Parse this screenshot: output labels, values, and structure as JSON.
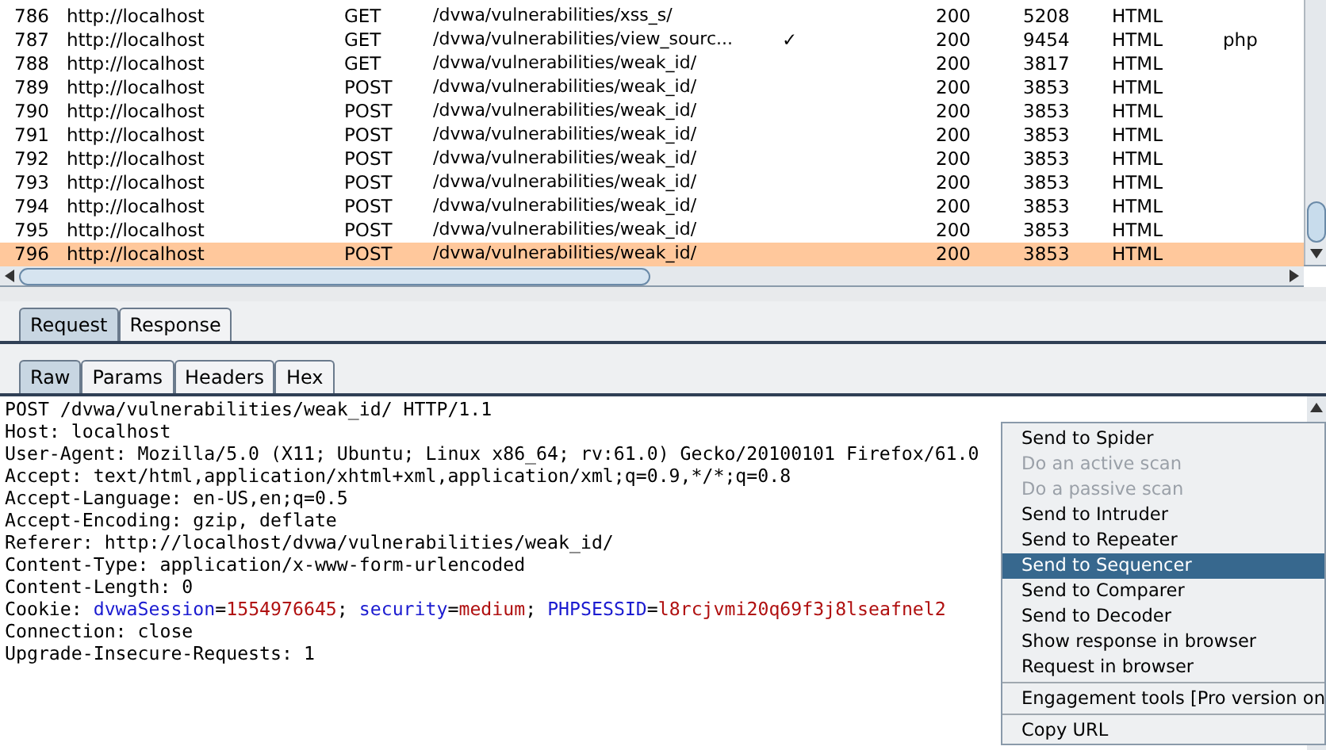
{
  "history_table": {
    "rows": [
      {
        "number": "786",
        "host": "http://localhost",
        "method": "GET",
        "url": "/dvwa/vulnerabilities/xss_s/",
        "column_5": "",
        "status": "200",
        "length": "5208",
        "mime_type": "HTML",
        "extension": "",
        "selected": false
      },
      {
        "number": "787",
        "host": "http://localhost",
        "method": "GET",
        "url": "/dvwa/vulnerabilities/view_sourc...",
        "column_5": "✓",
        "status": "200",
        "length": "9454",
        "mime_type": "HTML",
        "extension": "php",
        "selected": false
      },
      {
        "number": "788",
        "host": "http://localhost",
        "method": "GET",
        "url": "/dvwa/vulnerabilities/weak_id/",
        "column_5": "",
        "status": "200",
        "length": "3817",
        "mime_type": "HTML",
        "extension": "",
        "selected": false
      },
      {
        "number": "789",
        "host": "http://localhost",
        "method": "POST",
        "url": "/dvwa/vulnerabilities/weak_id/",
        "column_5": "",
        "status": "200",
        "length": "3853",
        "mime_type": "HTML",
        "extension": "",
        "selected": false
      },
      {
        "number": "790",
        "host": "http://localhost",
        "method": "POST",
        "url": "/dvwa/vulnerabilities/weak_id/",
        "column_5": "",
        "status": "200",
        "length": "3853",
        "mime_type": "HTML",
        "extension": "",
        "selected": false
      },
      {
        "number": "791",
        "host": "http://localhost",
        "method": "POST",
        "url": "/dvwa/vulnerabilities/weak_id/",
        "column_5": "",
        "status": "200",
        "length": "3853",
        "mime_type": "HTML",
        "extension": "",
        "selected": false
      },
      {
        "number": "792",
        "host": "http://localhost",
        "method": "POST",
        "url": "/dvwa/vulnerabilities/weak_id/",
        "column_5": "",
        "status": "200",
        "length": "3853",
        "mime_type": "HTML",
        "extension": "",
        "selected": false
      },
      {
        "number": "793",
        "host": "http://localhost",
        "method": "POST",
        "url": "/dvwa/vulnerabilities/weak_id/",
        "column_5": "",
        "status": "200",
        "length": "3853",
        "mime_type": "HTML",
        "extension": "",
        "selected": false
      },
      {
        "number": "794",
        "host": "http://localhost",
        "method": "POST",
        "url": "/dvwa/vulnerabilities/weak_id/",
        "column_5": "",
        "status": "200",
        "length": "3853",
        "mime_type": "HTML",
        "extension": "",
        "selected": false
      },
      {
        "number": "795",
        "host": "http://localhost",
        "method": "POST",
        "url": "/dvwa/vulnerabilities/weak_id/",
        "column_5": "",
        "status": "200",
        "length": "3853",
        "mime_type": "HTML",
        "extension": "",
        "selected": false
      },
      {
        "number": "796",
        "host": "http://localhost",
        "method": "POST",
        "url": "/dvwa/vulnerabilities/weak_id/",
        "column_5": "",
        "status": "200",
        "length": "3853",
        "mime_type": "HTML",
        "extension": "",
        "selected": true
      }
    ]
  },
  "message_tabs": [
    {
      "label": "Request",
      "selected": true
    },
    {
      "label": "Response",
      "selected": false
    }
  ],
  "view_tabs": [
    {
      "label": "Raw",
      "selected": true
    },
    {
      "label": "Params",
      "selected": false
    },
    {
      "label": "Headers",
      "selected": false
    },
    {
      "label": "Hex",
      "selected": false
    }
  ],
  "request_lines": [
    {
      "segments": [
        {
          "text": "POST /dvwa/vulnerabilities/weak_id/ HTTP/1.1",
          "kind": "plain"
        }
      ]
    },
    {
      "segments": [
        {
          "text": "Host: localhost",
          "kind": "plain"
        }
      ]
    },
    {
      "segments": [
        {
          "text": "User-Agent: Mozilla/5.0 (X11; Ubuntu; Linux x86_64; rv:61.0) Gecko/20100101 Firefox/61.0",
          "kind": "plain"
        }
      ]
    },
    {
      "segments": [
        {
          "text": "Accept: text/html,application/xhtml+xml,application/xml;q=0.9,*/*;q=0.8",
          "kind": "plain"
        }
      ]
    },
    {
      "segments": [
        {
          "text": "Accept-Language: en-US,en;q=0.5",
          "kind": "plain"
        }
      ]
    },
    {
      "segments": [
        {
          "text": "Accept-Encoding: gzip, deflate",
          "kind": "plain"
        }
      ]
    },
    {
      "segments": [
        {
          "text": "Referer: http://localhost/dvwa/vulnerabilities/weak_id/",
          "kind": "plain"
        }
      ]
    },
    {
      "segments": [
        {
          "text": "Content-Type: application/x-www-form-urlencoded",
          "kind": "plain"
        }
      ]
    },
    {
      "segments": [
        {
          "text": "Content-Length: 0",
          "kind": "plain"
        }
      ]
    },
    {
      "segments": [
        {
          "text": "Cookie: ",
          "kind": "plain"
        },
        {
          "text": "dvwaSession",
          "kind": "name"
        },
        {
          "text": "=",
          "kind": "plain"
        },
        {
          "text": "1554976645",
          "kind": "value"
        },
        {
          "text": "; ",
          "kind": "plain"
        },
        {
          "text": "security",
          "kind": "name"
        },
        {
          "text": "=",
          "kind": "plain"
        },
        {
          "text": "medium",
          "kind": "value"
        },
        {
          "text": "; ",
          "kind": "plain"
        },
        {
          "text": "PHPSESSID",
          "kind": "name"
        },
        {
          "text": "=",
          "kind": "plain"
        },
        {
          "text": "l8rcjvmi20q69f3j8lseafnel2",
          "kind": "value"
        }
      ]
    },
    {
      "segments": [
        {
          "text": "Connection: close",
          "kind": "plain"
        }
      ]
    },
    {
      "segments": [
        {
          "text": "Upgrade-Insecure-Requests: 1",
          "kind": "plain"
        }
      ]
    }
  ],
  "context_menu": [
    {
      "label": "Send to Spider",
      "disabled": false,
      "selected": false,
      "separator_before": false
    },
    {
      "label": "Do an active scan",
      "disabled": true,
      "selected": false,
      "separator_before": false
    },
    {
      "label": "Do a passive scan",
      "disabled": true,
      "selected": false,
      "separator_before": false
    },
    {
      "label": "Send to Intruder",
      "disabled": false,
      "selected": false,
      "separator_before": false
    },
    {
      "label": "Send to Repeater",
      "disabled": false,
      "selected": false,
      "separator_before": false
    },
    {
      "label": "Send to Sequencer",
      "disabled": false,
      "selected": true,
      "separator_before": false
    },
    {
      "label": "Send to Comparer",
      "disabled": false,
      "selected": false,
      "separator_before": false
    },
    {
      "label": "Send to Decoder",
      "disabled": false,
      "selected": false,
      "separator_before": false
    },
    {
      "label": "Show response in browser",
      "disabled": false,
      "selected": false,
      "separator_before": false
    },
    {
      "label": "Request in browser",
      "disabled": false,
      "selected": false,
      "separator_before": false
    },
    {
      "label": "Engagement tools [Pro version on",
      "disabled": false,
      "selected": false,
      "separator_before": true
    },
    {
      "label": "Copy URL",
      "disabled": false,
      "selected": false,
      "separator_before": true
    }
  ]
}
